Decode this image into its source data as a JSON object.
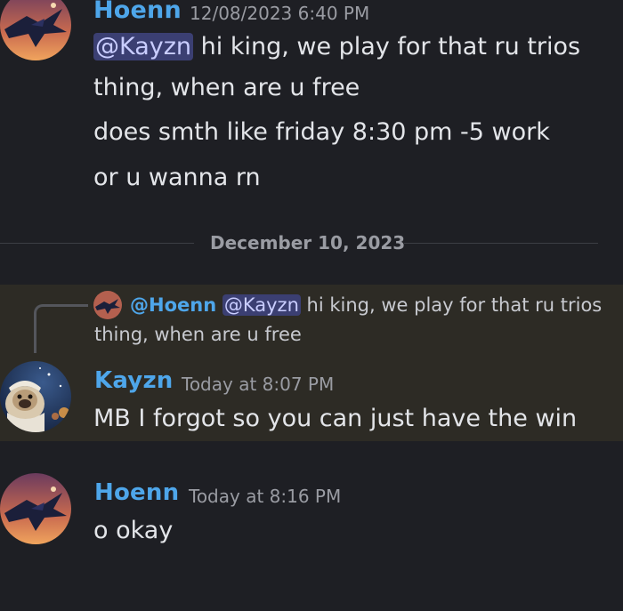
{
  "messages": [
    {
      "author": "Hoenn",
      "timestamp": "12/08/2023 6:40 PM",
      "mention": "@Kayzn",
      "lines": [
        " hi king, we play for that ru trios",
        "thing, when are u free",
        "does smth like friday 8:30 pm -5 work",
        "or u wanna rn"
      ]
    },
    {
      "author": "Kayzn",
      "timestamp": "Today at 8:07 PM",
      "reply": {
        "reply_to": "@Hoenn",
        "mention": "@Kayzn",
        "text_line1": " hi king, we play for that ru trios",
        "text_line2": "thing, when are u free"
      },
      "lines": [
        "MB I forgot so you can just have the win"
      ]
    },
    {
      "author": "Hoenn",
      "timestamp": "Today at 8:16 PM",
      "lines": [
        "o okay"
      ]
    }
  ],
  "divider": {
    "date": "December 10, 2023"
  },
  "colors": {
    "background": "#1e1f24",
    "username": "#4ea6ea",
    "mention_bg": "#3b3f72",
    "highlight_bg": "#2d2b25"
  },
  "icons": {
    "hoenn_avatar": "crow-avatar-icon",
    "kayzn_avatar": "pug-avatar-icon"
  }
}
